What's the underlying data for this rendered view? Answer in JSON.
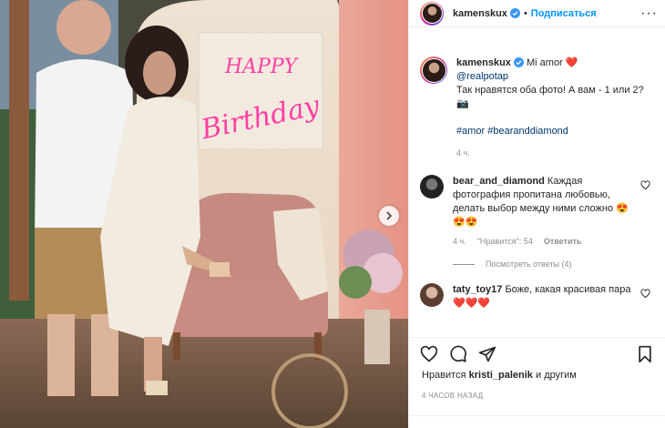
{
  "post": {
    "username": "kamenskux",
    "follow_label": "Подписаться",
    "dot": "•",
    "more_label": "···"
  },
  "caption": {
    "username": "kamenskux",
    "text_1": "Mi amor ❤️",
    "mention": "@realpotap",
    "text_2": "Так нравятся оба фото! А вам - 1 или 2?📷",
    "hashtags": "#amor #bearanddiamond",
    "time": "4 ч."
  },
  "comments": [
    {
      "username": "bear_and_diamond",
      "text": "Каждая фотография пропитана любовью, делать выбор между ними сложно 😍😍😍",
      "time": "4 ч.",
      "likes": "\"Нравится\": 54",
      "reply_label": "Ответить",
      "view_replies": "Посмотреть ответы (4)"
    },
    {
      "username": "taty_toy17",
      "text": "Боже, какая красивая пара❤️❤️❤️"
    }
  ],
  "likes_line": {
    "prefix": "Нравится",
    "user": "kristi_palenik",
    "suffix": "и другим"
  },
  "timestamp": "4 ЧАСОВ НАЗАД",
  "photo": {
    "neon_line1": "HAPPY",
    "neon_line2": "Birthday"
  },
  "colors": {
    "accent": "#0095f6",
    "verified": "#3897f0",
    "neon": "#ff3fa4"
  },
  "icons": [
    "heart-icon",
    "comment-icon",
    "share-icon",
    "bookmark-icon",
    "verified-icon",
    "chevron-right-icon"
  ]
}
